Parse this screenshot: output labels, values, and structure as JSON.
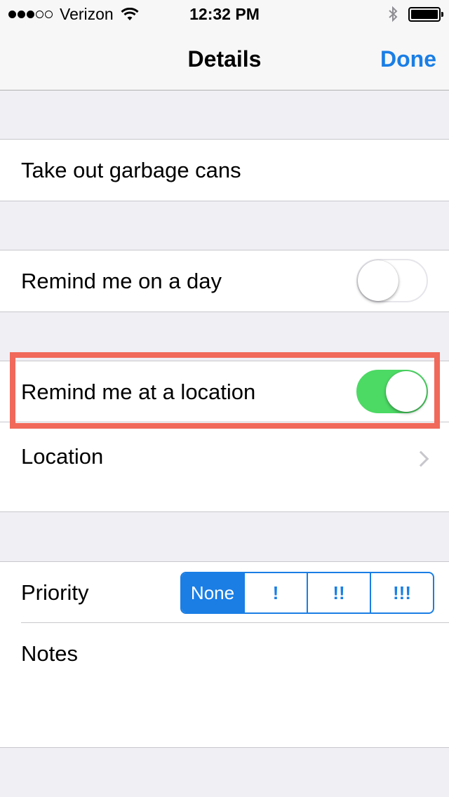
{
  "status_bar": {
    "carrier": "Verizon",
    "time": "12:32 PM",
    "signal_bars_filled": 3,
    "signal_bars_total": 5
  },
  "nav": {
    "title": "Details",
    "done_label": "Done"
  },
  "task": {
    "title": "Take out garbage cans"
  },
  "reminders": {
    "day_label": "Remind me on a day",
    "day_enabled": false,
    "location_toggle_label": "Remind me at a location",
    "location_enabled": true,
    "location_label": "Location"
  },
  "priority": {
    "label": "Priority",
    "options": [
      "None",
      "!",
      "!!",
      "!!!"
    ],
    "selected": "None"
  },
  "notes": {
    "label": "Notes"
  },
  "colors": {
    "accent": "#1a7ee5",
    "toggle_on": "#4cd964",
    "highlight": "#f0695a",
    "background": "#efeff4"
  }
}
